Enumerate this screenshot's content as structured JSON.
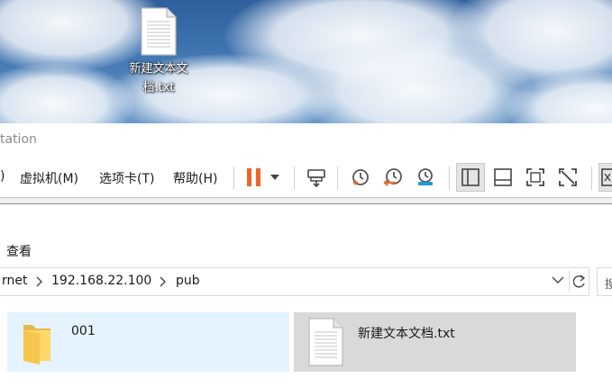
{
  "desktop": {
    "file_name": "新建文本文档.txt",
    "file_icon": "text-document-icon"
  },
  "window": {
    "title_partial": "tation",
    "menu": {
      "partial_first": ")",
      "vm": "虚拟机(M)",
      "tabs": "选项卡(T)",
      "help": "帮助(H)"
    },
    "toolbar_icons": [
      "pause-icon",
      "dropdown-arrow-icon",
      "send-keys-icon",
      "snapshot-take-icon",
      "snapshot-revert-icon",
      "snapshot-manager-icon",
      "show-library-icon",
      "show-thumbnail-bar-icon",
      "fullscreen-icon",
      "unity-icon",
      "console-view-icon"
    ],
    "accent_colors": {
      "pause": "#e8672a",
      "revert": "#e8672a",
      "manager": "#1f9bd1"
    }
  },
  "explorer": {
    "ribbon_tab_view": "查看",
    "address": {
      "crumbs": [
        "rnet",
        "192.168.22.100",
        "pub"
      ]
    },
    "search_hint": "搜",
    "files": [
      {
        "name": "001",
        "type": "folder",
        "state": "hover"
      },
      {
        "name": "新建文本文档.txt",
        "type": "text",
        "state": "selected"
      }
    ]
  }
}
